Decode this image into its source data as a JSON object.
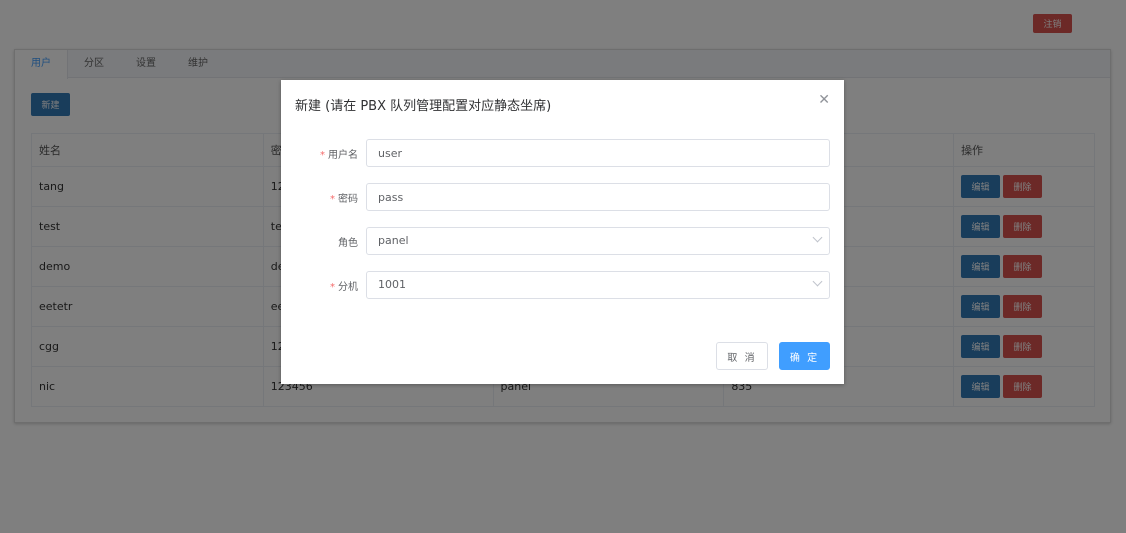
{
  "header": {
    "logout_label": "注销"
  },
  "tabs": [
    {
      "label": "用户"
    },
    {
      "label": "分区"
    },
    {
      "label": "设置"
    },
    {
      "label": "维护"
    }
  ],
  "toolbar": {
    "new_label": "新建"
  },
  "table": {
    "columns": [
      "姓名",
      "密码",
      "",
      "",
      "操作"
    ],
    "rows": [
      {
        "cells": [
          "tang",
          "12",
          "",
          "",
          ""
        ]
      },
      {
        "cells": [
          "test",
          "te",
          "",
          "",
          ""
        ]
      },
      {
        "cells": [
          "demo",
          "de",
          "",
          "",
          ""
        ]
      },
      {
        "cells": [
          "eetetr",
          "ee",
          "",
          "",
          ""
        ]
      },
      {
        "cells": [
          "cgg",
          "12",
          "",
          "",
          ""
        ]
      },
      {
        "cells": [
          "nic",
          "123456",
          "panel",
          "835",
          ""
        ]
      }
    ],
    "edit_label": "编辑",
    "delete_label": "删除"
  },
  "modal": {
    "title": "新建 (请在 PBX 队列管理配置对应静态坐席)",
    "fields": [
      {
        "label": "用户名",
        "required": true,
        "value": "user",
        "type": "input"
      },
      {
        "label": "密码",
        "required": true,
        "value": "pass",
        "type": "input"
      },
      {
        "label": "角色",
        "required": false,
        "value": "panel",
        "type": "select"
      },
      {
        "label": "分机",
        "required": true,
        "value": "1001",
        "type": "select"
      }
    ],
    "cancel_label": "取 消",
    "ok_label": "确 定"
  },
  "colors": {
    "primary": "#409eff",
    "danger": "#d9534f",
    "button_blue": "#337ab7"
  }
}
